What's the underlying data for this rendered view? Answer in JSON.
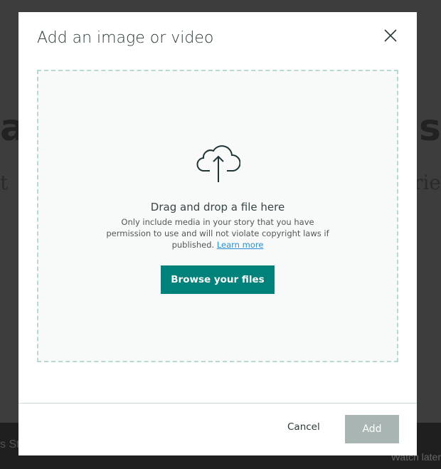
{
  "background": {
    "title_left": "a",
    "title_right": "ds",
    "sub_left": "t",
    "sub_right": "rie",
    "small": "s Sto",
    "watch": "Watch later"
  },
  "dialog": {
    "title": "Add an image or video",
    "close_icon": "close-icon",
    "dropzone": {
      "icon": "cloud-upload-icon",
      "heading": "Drag and drop a file here",
      "text": "Only include media in your story that you have permission to use and will not violate copyright laws if published.",
      "link": "Learn more",
      "browse_label": "Browse your files"
    },
    "footer": {
      "cancel_label": "Cancel",
      "add_label": "Add"
    }
  },
  "colors": {
    "accent": "#00827a",
    "disabled": "#a9b5b3",
    "link": "#2a8fd6"
  }
}
